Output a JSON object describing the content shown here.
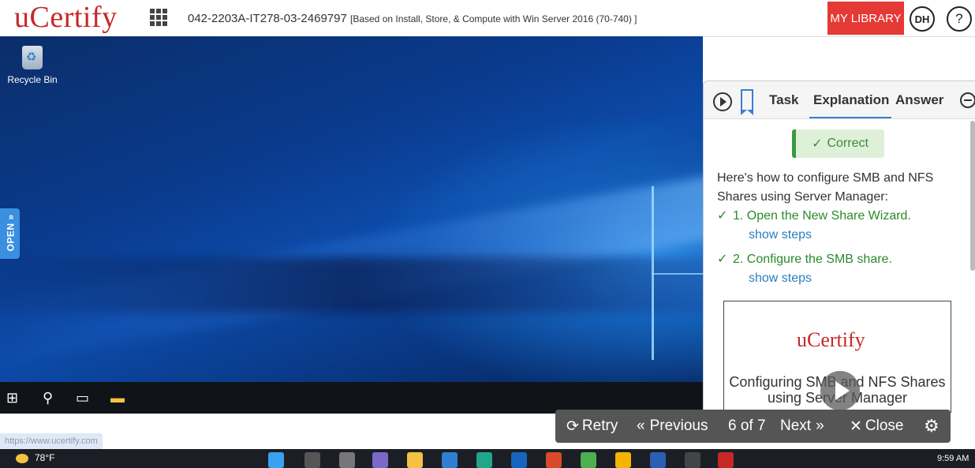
{
  "header": {
    "logo": "uCertify",
    "course_title": "042-2203A-IT278-03-2469797",
    "course_subtitle": "[Based on Install, Store, & Compute with Win Server 2016 (70-740) ]",
    "my_library": "MY LIBRARY",
    "avatar_initials": "DH",
    "help": "?"
  },
  "desktop": {
    "recycle_bin_label": "Recycle Bin",
    "open_tab": "OPEN »"
  },
  "panel": {
    "tabs": [
      "Task",
      "Explanation",
      "Answer"
    ],
    "active_tab": "Explanation",
    "correct_label": "Correct",
    "intro": "Here's how to configure SMB and NFS Shares using Server Manager:",
    "steps": [
      {
        "text": "1. Open the New Share Wizard.",
        "link": "show steps"
      },
      {
        "text": "2. Configure the SMB share.",
        "link": "show steps"
      }
    ],
    "video": {
      "logo": "uCertify",
      "title": "Configuring SMB and NFS Shares using Server Manager"
    }
  },
  "controls": {
    "retry": "Retry",
    "previous": "Previous",
    "position": "6 of 7",
    "next": "Next",
    "close": "Close"
  },
  "status_url": "https://www.ucertify.com",
  "host_taskbar": {
    "weather": "78°F",
    "time": "9:59 AM"
  }
}
